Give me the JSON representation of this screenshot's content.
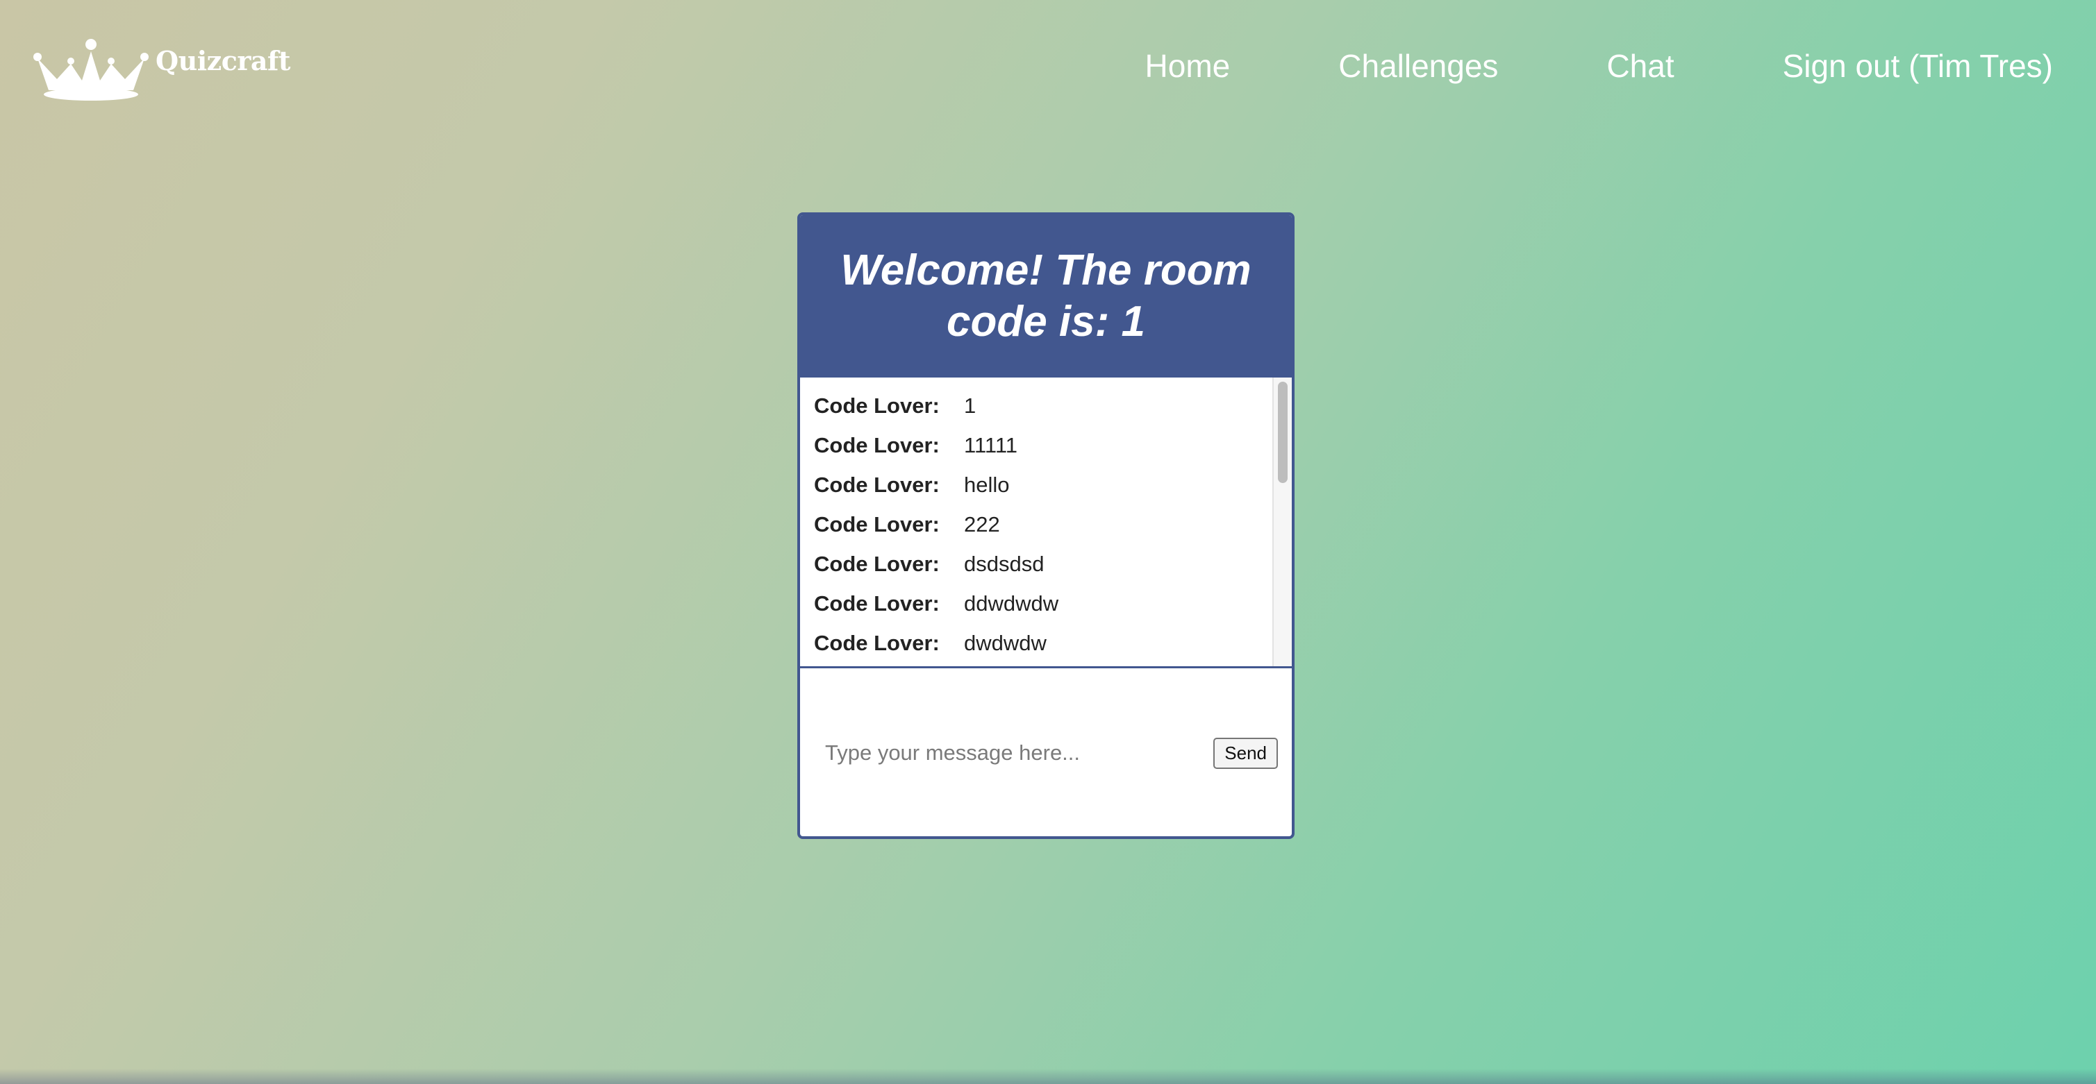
{
  "header": {
    "brand": "Quizcraft",
    "logo_icon": "crown-icon",
    "nav": [
      {
        "label": "Home"
      },
      {
        "label": "Challenges"
      },
      {
        "label": "Chat"
      },
      {
        "label": "Sign out (Tim Tres)"
      }
    ]
  },
  "chat": {
    "title": "Welcome! The room code is: 1",
    "messages": [
      {
        "user": "Code Lover:",
        "text": "1"
      },
      {
        "user": "Code Lover:",
        "text": "11111"
      },
      {
        "user": "Code Lover:",
        "text": "hello"
      },
      {
        "user": "Code Lover:",
        "text": "222"
      },
      {
        "user": "Code Lover:",
        "text": "dsdsdsd"
      },
      {
        "user": "Code Lover:",
        "text": "ddwdwdw"
      },
      {
        "user": "Code Lover:",
        "text": "dwdwdw"
      }
    ],
    "input": {
      "value": "",
      "placeholder": "Type your message here..."
    },
    "send_label": "Send"
  },
  "colors": {
    "card_accent": "#42578f",
    "background_start": "#c9c6a6",
    "background_end": "#6dd1ad"
  }
}
